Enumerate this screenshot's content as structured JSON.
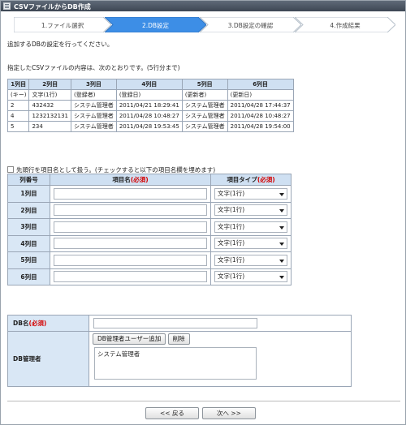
{
  "window": {
    "title": "CSVファイルからDB作成"
  },
  "steps": [
    {
      "label": "1.ファイル選択",
      "active": false
    },
    {
      "label": "2.DB設定",
      "active": true
    },
    {
      "label": "3.DB設定の確認",
      "active": false
    },
    {
      "label": "4.作成結果",
      "active": false
    }
  ],
  "colors": {
    "step_active": "#3d8ee6",
    "step_inactive": "#ffffff",
    "header_bg": "#cfe0f2",
    "required": "#d40000"
  },
  "intro": "追加するDBの設定を行ってください。",
  "csv_note": "指定したCSVファイルの内容は、次のとおりです。(5行分まで)",
  "csv_table": {
    "headers": [
      "1列目",
      "2列目",
      "3列目",
      "4列目",
      "5列目",
      "6列目"
    ],
    "rows": [
      [
        "(キー)",
        "文字(1行)",
        "(登録者)",
        "(登録日)",
        "(更新者)",
        "(更新日)"
      ],
      [
        "2",
        "432432",
        "システム管理者",
        "2011/04/21 18:29:41",
        "システム管理者",
        "2011/04/28 17:44:37"
      ],
      [
        "4",
        "1232132131",
        "システム管理者",
        "2011/04/28 10:48:27",
        "システム管理者",
        "2011/04/28 10:48:27"
      ],
      [
        "5",
        "234",
        "システム管理者",
        "2011/04/28 19:53:45",
        "システム管理者",
        "2011/04/28 19:54:00"
      ]
    ]
  },
  "first_row_option": "先頭行を項目名として扱う。(チェックすると以下の項目名欄を埋めます)",
  "column_table": {
    "header_num": "列番号",
    "header_name": "項目名",
    "header_type": "項目タイプ",
    "required": "(必須)",
    "rows": [
      {
        "label": "1列目",
        "name": "",
        "type": "文字(1行)"
      },
      {
        "label": "2列目",
        "name": "",
        "type": "文字(1行)"
      },
      {
        "label": "3列目",
        "name": "",
        "type": "文字(1行)"
      },
      {
        "label": "4列目",
        "name": "",
        "type": "文字(1行)"
      },
      {
        "label": "5列目",
        "name": "",
        "type": "文字(1行)"
      },
      {
        "label": "6列目",
        "name": "",
        "type": "文字(1行)"
      }
    ]
  },
  "db": {
    "name_label": "DB名",
    "required": "(必須)",
    "name_value": "",
    "admin_label": "DB管理者",
    "add_admin_button": "DB管理者ユーザー追加",
    "delete_button": "削除",
    "admins": [
      "システム管理者"
    ]
  },
  "nav": {
    "back": "<< 戻る",
    "next": "次へ >>"
  }
}
